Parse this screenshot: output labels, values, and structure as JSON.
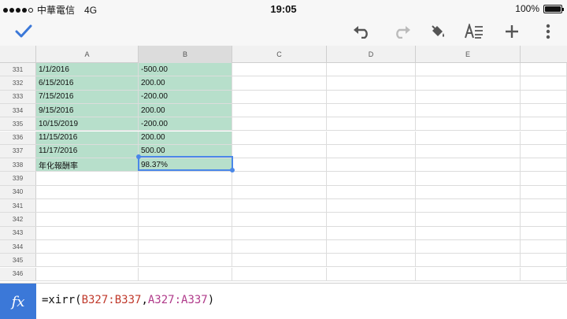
{
  "status": {
    "signal_bars": 5,
    "signal_filled": 4,
    "carrier": "中華電信",
    "network": "4G",
    "time": "19:05",
    "battery": "100%",
    "battery_level": 1.0
  },
  "toolbar": {
    "icons": [
      "check-icon",
      "undo-icon",
      "redo-icon",
      "paint-bucket-icon",
      "text-format-icon",
      "plus-icon",
      "more-vert-icon"
    ],
    "accent": "#3b78d8"
  },
  "sheet": {
    "columns": [
      "A",
      "B",
      "C",
      "D",
      "E"
    ],
    "selected_column": "B",
    "rows": [
      {
        "num": "331",
        "a": "1/1/2016",
        "b": "-500.00"
      },
      {
        "num": "332",
        "a": "6/15/2016",
        "b": "200.00"
      },
      {
        "num": "333",
        "a": "7/15/2016",
        "b": "-200.00"
      },
      {
        "num": "334",
        "a": "9/15/2016",
        "b": "200.00"
      },
      {
        "num": "335",
        "a": "10/15/2019",
        "b": "-200.00"
      },
      {
        "num": "336",
        "a": "11/15/2016",
        "b": "200.00"
      },
      {
        "num": "337",
        "a": "11/17/2016",
        "b": "500.00"
      },
      {
        "num": "338",
        "a": "年化報酬率",
        "b": "98.37%"
      },
      {
        "num": "339",
        "a": "",
        "b": ""
      },
      {
        "num": "340",
        "a": "",
        "b": ""
      },
      {
        "num": "341",
        "a": "",
        "b": ""
      },
      {
        "num": "342",
        "a": "",
        "b": ""
      },
      {
        "num": "343",
        "a": "",
        "b": ""
      },
      {
        "num": "344",
        "a": "",
        "b": ""
      },
      {
        "num": "345",
        "a": "",
        "b": ""
      },
      {
        "num": "346",
        "a": "",
        "b": ""
      }
    ],
    "highlight_color": "#b7dfcb",
    "selected_cell": "B338"
  },
  "formula_bar": {
    "fx_label": "fx",
    "prefix": "=xirr(",
    "range1": "B327:B337",
    "comma": ",",
    "range2": "A327:A337",
    "suffix": ")"
  }
}
